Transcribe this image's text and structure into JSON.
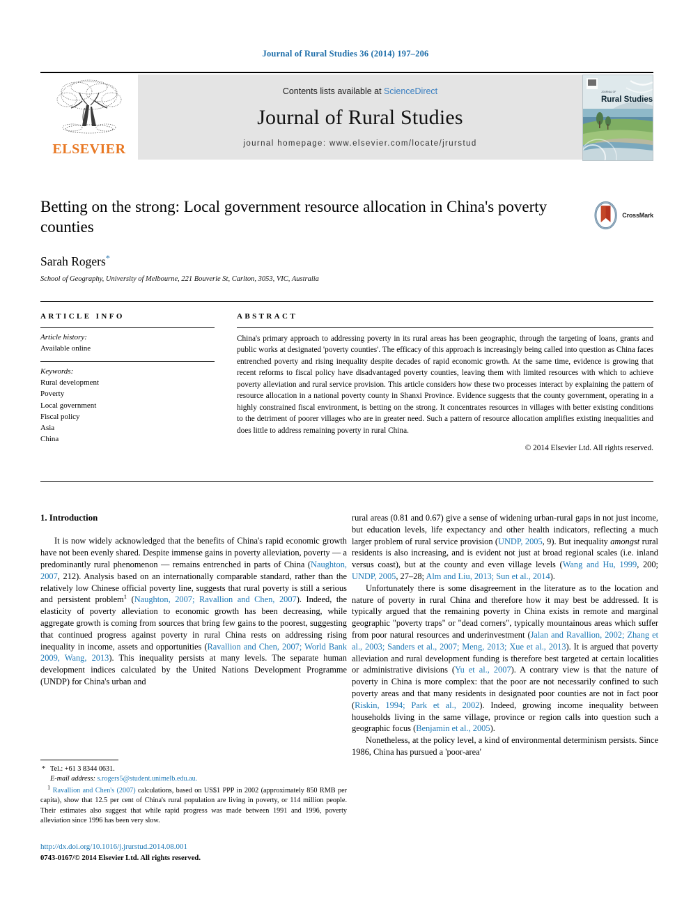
{
  "running_head": "Journal of Rural Studies 36 (2014) 197–206",
  "banner": {
    "contents_prefix": "Contents lists available at ",
    "sciencedirect": "ScienceDirect",
    "journal_title": "Journal of Rural Studies",
    "homepage": "journal homepage: www.elsevier.com/locate/jrurstud",
    "publisher": "ELSEVIER",
    "cover_label_small": "JOURNAL OF",
    "cover_label": "Rural Studies",
    "link_color": "#3a7fc1",
    "elsevier_orange": "#E87722"
  },
  "title_block": {
    "title": "Betting on the strong: Local government resource allocation in China's poverty counties",
    "author": "Sarah Rogers",
    "author_mark": "*",
    "affiliation": "School of Geography, University of Melbourne, 221 Bouverie St, Carlton, 3053, VIC, Australia",
    "crossmark_label": "CrossMark"
  },
  "article_info": {
    "heading": "ARTICLE INFO",
    "history_label": "Article history:",
    "history_value": "Available online",
    "keywords_label": "Keywords:",
    "keywords": [
      "Rural development",
      "Poverty",
      "Local government",
      "Fiscal policy",
      "Asia",
      "China"
    ]
  },
  "abstract": {
    "heading": "ABSTRACT",
    "text": "China's primary approach to addressing poverty in its rural areas has been geographic, through the targeting of loans, grants and public works at designated 'poverty counties'. The efficacy of this approach is increasingly being called into question as China faces entrenched poverty and rising inequality despite decades of rapid economic growth. At the same time, evidence is growing that recent reforms to fiscal policy have disadvantaged poverty counties, leaving them with limited resources with which to achieve poverty alleviation and rural service provision. This article considers how these two processes interact by explaining the pattern of resource allocation in a national poverty county in Shanxi Province. Evidence suggests that the county government, operating in a highly constrained fiscal environment, is betting on the strong. It concentrates resources in villages with better existing conditions to the detriment of poorer villages who are in greater need. Such a pattern of resource allocation amplifies existing inequalities and does little to address remaining poverty in rural China.",
    "copyright": "© 2014 Elsevier Ltd. All rights reserved."
  },
  "body": {
    "section_heading": "1. Introduction",
    "left_paragraph_1_a": "It is now widely acknowledged that the benefits of China's rapid economic growth have not been evenly shared. Despite immense gains in poverty alleviation, poverty — a predominantly rural phenomenon — remains entrenched in parts of China (",
    "ref_naughton_2007": "Naughton, 2007",
    "left_paragraph_1_b": ", 212). Analysis based on an internationally comparable standard, rather than the relatively low Chinese official poverty line, suggests that rural poverty is still a serious and persistent problem",
    "footnote_marker_1": "1",
    "left_paragraph_1_c": " (",
    "ref_naughton_ravallion": "Naughton, 2007; Ravallion and Chen, 2007",
    "left_paragraph_1_d": "). Indeed, the elasticity of poverty alleviation to economic growth has been decreasing, while aggregate growth is coming from sources that bring few gains to the poorest, suggesting that continued progress against poverty in rural China rests on addressing rising inequality in income, assets and opportunities (",
    "ref_ravallion_world_bank": "Ravallion and Chen, 2007; World Bank 2009, Wang, 2013",
    "left_paragraph_1_e": "). This inequality persists at many levels. The separate human development indices calculated by the United Nations Development Programme (UNDP) for China's urban and",
    "right_paragraph_1_a": "rural areas (0.81 and 0.67) give a sense of widening urban-rural gaps in not just income, but education levels, life expectancy and other health indicators, reflecting a much larger problem of rural service provision (",
    "ref_undp_2005": "UNDP, 2005",
    "right_paragraph_1_b": ", 9). But inequality ",
    "right_paragraph_1_italic": "amongst",
    "right_paragraph_1_c": " rural residents is also increasing, and is evident not just at broad regional scales (i.e. inland versus coast), but at the county and even village levels (",
    "ref_wang_hu": "Wang and Hu, 1999",
    "right_paragraph_1_d": ", 200; ",
    "ref_undp_2005_b": "UNDP, 2005",
    "right_paragraph_1_e": ", 27–28; ",
    "ref_alm_liu_sun": "Alm and Liu, 2013; Sun et al., 2014",
    "right_paragraph_1_f": ").",
    "right_paragraph_2_a": "Unfortunately there is some disagreement in the literature as to the location and nature of poverty in rural China and therefore how it may best be addressed. It is typically argued that the remaining poverty in China exists in remote and marginal geographic \"poverty traps\" or \"dead corners\", typically mountainous areas which suffer from poor natural resources and underinvestment (",
    "ref_jalan_etal": "Jalan and Ravallion, 2002; Zhang et al., 2003; Sanders et al., 2007; Meng, 2013; Xue et al., 2013",
    "right_paragraph_2_b": "). It is argued that poverty alleviation and rural development funding is therefore best targeted at certain localities or administrative divisions (",
    "ref_yu_2007": "Yu et al., 2007",
    "right_paragraph_2_c": "). A contrary view is that the nature of poverty in China is more complex: that the poor are not necessarily confined to such poverty areas and that many residents in designated poor counties are not in fact poor (",
    "ref_riskin_park": "Riskin, 1994; Park et al., 2002",
    "right_paragraph_2_d": "). Indeed, growing income inequality between households living in the same village, province or region calls into question such a geographic focus (",
    "ref_benjamin_2005": "Benjamin et al., 2005",
    "right_paragraph_2_e": ").",
    "right_paragraph_3": "Nonetheless, at the policy level, a kind of environmental determinism persists. Since 1986, China has pursued a 'poor-area'"
  },
  "footnotes": {
    "tel_mark": "*",
    "tel": "Tel.: +61 3 8344 0631.",
    "email_label": "E-mail address:",
    "email": "s.rogers5@student.unimelb.edu.au.",
    "note1_mark": "1",
    "note1_ref": "Ravallion and Chen's (2007)",
    "note1_text": " calculations, based on US$1 PPP in 2002 (approximately 850 RMB per capita), show that 12.5 per cent of China's rural population are living in poverty, or 114 million people. Their estimates also suggest that while rapid progress was made between 1991 and 1996, poverty alleviation since 1996 has been very slow."
  },
  "footer": {
    "doi": "http://dx.doi.org/10.1016/j.jrurstud.2014.08.001",
    "issn_line": "0743-0167/© 2014 Elsevier Ltd. All rights reserved."
  }
}
